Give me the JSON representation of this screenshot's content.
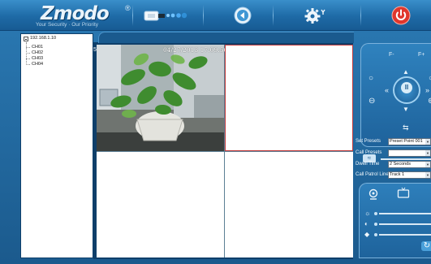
{
  "brand": {
    "logo_text": "Zmodo",
    "registered_mark": "®",
    "slogan": "Your Security · Our Priority"
  },
  "toolbar": {
    "buttons": [
      {
        "name": "record",
        "icon": "camera-record-icon"
      },
      {
        "name": "playback",
        "icon": "playback-icon"
      },
      {
        "name": "settings",
        "icon": "gear-icon"
      },
      {
        "name": "power",
        "icon": "power-icon"
      }
    ]
  },
  "tree": {
    "root": "192.168.1.10",
    "channels": [
      "CH01",
      "CH02",
      "CH03",
      "CH04"
    ]
  },
  "video": {
    "tile1_label": "5",
    "tile1_timestamp": "04/27/2013  17:09:56",
    "selected_tile": 2
  },
  "ptz": {
    "focus_minus": "F-",
    "focus_plus": "F+"
  },
  "controls": {
    "set_presets_label": "Set Presets",
    "set_presets_value": "Preset Point 001",
    "call_presets_label": "Call Presets",
    "call_presets_value": "",
    "dwell_time_label": "Dwell Time",
    "dwell_time_value": "2 Seconds",
    "patrol_line_label": "Call Patrol Line",
    "patrol_line_value": "Track 1"
  },
  "colors": {
    "background": "#1d5f95",
    "selected_tile_border": "#c43b3b",
    "power_button": "#e0362c"
  }
}
